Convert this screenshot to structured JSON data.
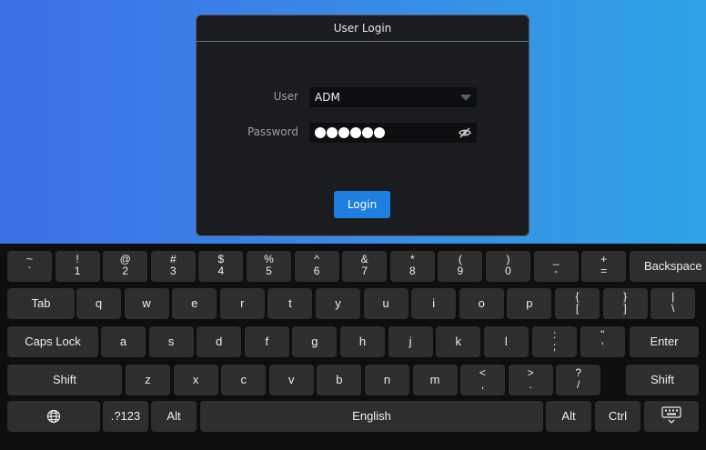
{
  "dialog": {
    "title": "User Login",
    "user_label": "User",
    "user_value": "ADM",
    "password_label": "Password",
    "password_mask_count": 6,
    "login_label": "Login"
  },
  "keyboard": {
    "row1": [
      {
        "upper": "~",
        "lower": "`"
      },
      {
        "upper": "!",
        "lower": "1"
      },
      {
        "upper": "@",
        "lower": "2"
      },
      {
        "upper": "#",
        "lower": "3"
      },
      {
        "upper": "$",
        "lower": "4"
      },
      {
        "upper": "%",
        "lower": "5"
      },
      {
        "upper": "^",
        "lower": "6"
      },
      {
        "upper": "&",
        "lower": "7"
      },
      {
        "upper": "*",
        "lower": "8"
      },
      {
        "upper": "(",
        "lower": "9"
      },
      {
        "upper": ")",
        "lower": "0"
      },
      {
        "upper": "_",
        "lower": "-"
      },
      {
        "upper": "+",
        "lower": "="
      }
    ],
    "backspace": "Backspace",
    "tab": "Tab",
    "row2": [
      "q",
      "w",
      "e",
      "r",
      "t",
      "y",
      "u",
      "i",
      "o",
      "p"
    ],
    "row2_sym": [
      {
        "upper": "{",
        "lower": "["
      },
      {
        "upper": "}",
        "lower": "]"
      },
      {
        "upper": "|",
        "lower": "\\"
      }
    ],
    "caps_lock": "Caps Lock",
    "row3": [
      "a",
      "s",
      "d",
      "f",
      "g",
      "h",
      "j",
      "k",
      "l"
    ],
    "row3_sym": [
      {
        "upper": ":",
        "lower": ";"
      },
      {
        "upper": "\"",
        "lower": "'"
      }
    ],
    "enter": "Enter",
    "shift": "Shift",
    "row4": [
      "z",
      "x",
      "c",
      "v",
      "b",
      "n",
      "m"
    ],
    "row4_sym": [
      {
        "upper": "<",
        "lower": ","
      },
      {
        "upper": ">",
        "lower": "."
      },
      {
        "upper": "?",
        "lower": "/"
      }
    ],
    "num_mode": ".?123",
    "alt": "Alt",
    "space": "English",
    "ctrl": "Ctrl",
    "icons": {
      "language": "globe-icon",
      "hide_keyboard": "keyboard-hide-icon",
      "password_visibility": "eye-off-icon",
      "user_dropdown": "chevron-down-icon"
    }
  }
}
